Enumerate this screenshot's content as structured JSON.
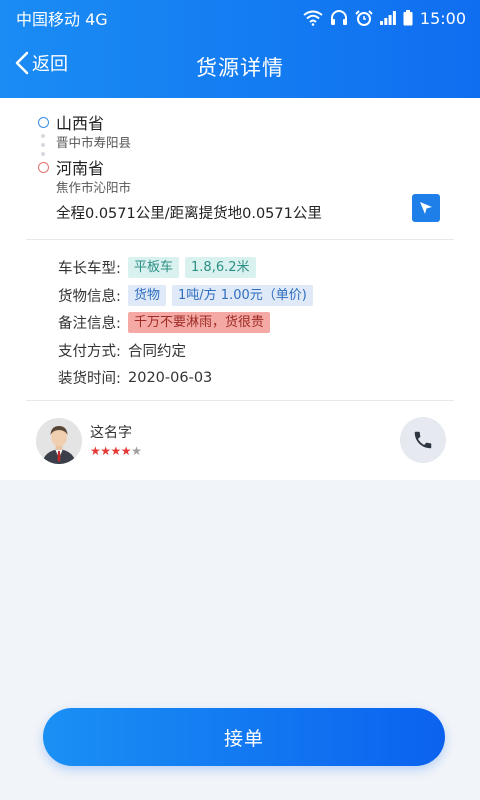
{
  "status_bar": {
    "carrier": "中国移动 4G",
    "time": "15:00",
    "icons": [
      "wifi-icon",
      "headphone-icon",
      "alarm-icon",
      "signal-icon",
      "battery-icon"
    ]
  },
  "nav": {
    "back_label": "返回",
    "title": "货源详情"
  },
  "route": {
    "start_province": "山西省",
    "start_city": "晋中市寿阳县",
    "end_province": "河南省",
    "end_city": "焦作市沁阳市",
    "distance": "全程0.0571公里/距离提货地0.0571公里"
  },
  "info": {
    "vehicle_label": "车长车型:",
    "vehicle_type": "平板车",
    "vehicle_length": "1.8,6.2米",
    "cargo_label": "货物信息:",
    "cargo_name": "货物",
    "cargo_price": "1吨/方 1.00元（单价)",
    "remark_label": "备注信息:",
    "remark": "千万不要淋雨，货很贵",
    "payment_label": "支付方式:",
    "payment": "合同约定",
    "loading_label": "装货时间:",
    "loading_date": "2020-06-03"
  },
  "owner": {
    "name": "这名字",
    "rating": 4,
    "rating_max": 5
  },
  "accept_button": "接单",
  "colors": {
    "primary": "#1a8cf4",
    "star": "#e53935"
  }
}
